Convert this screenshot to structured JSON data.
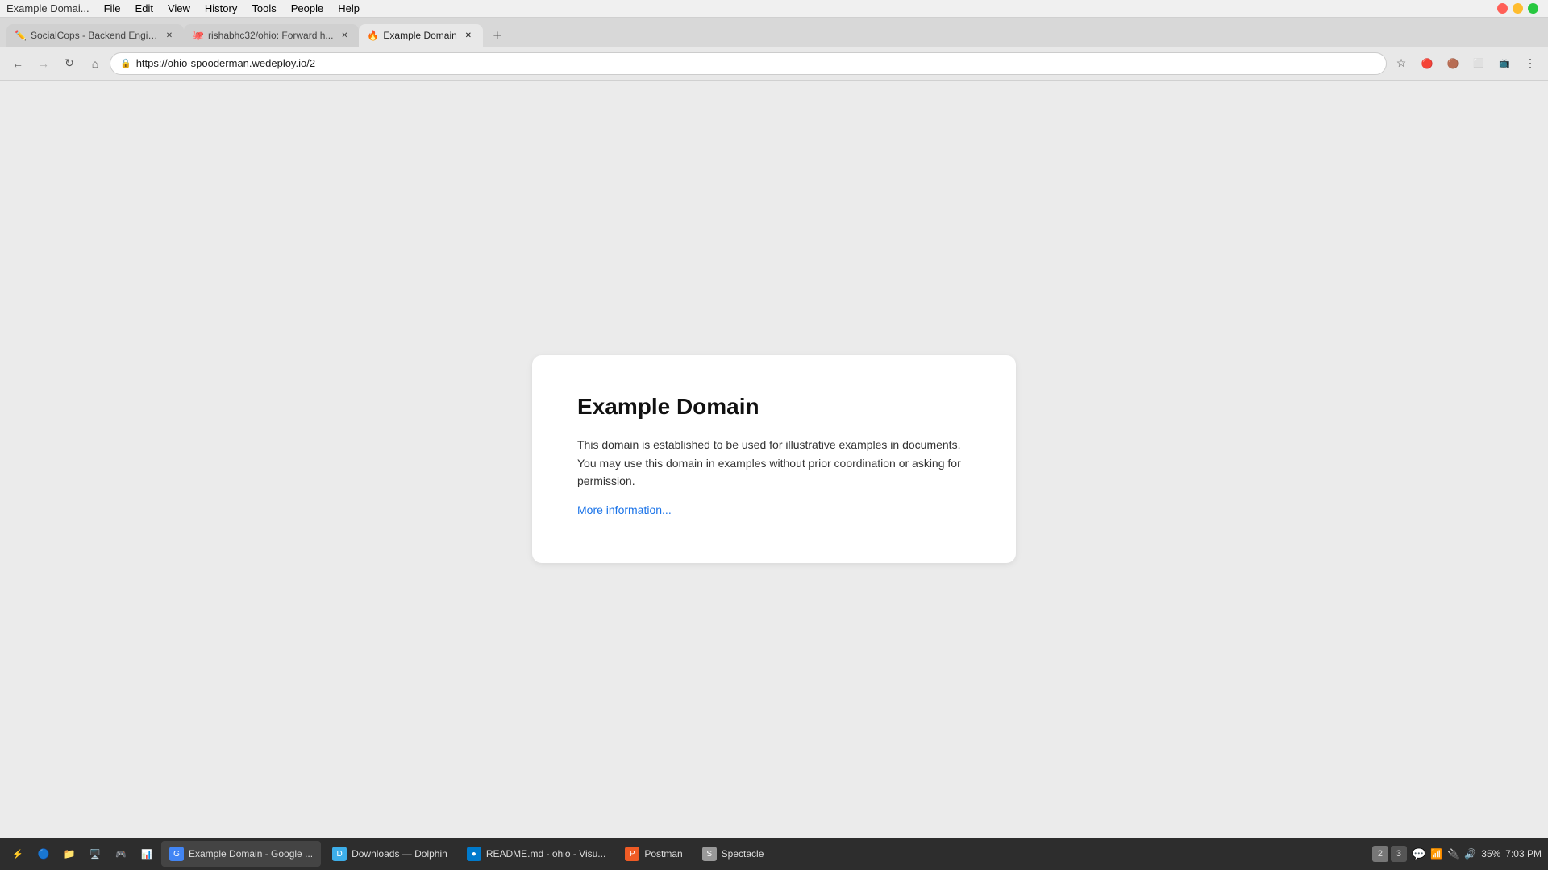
{
  "menubar": {
    "app_name": "Example Domai...",
    "items": [
      "File",
      "Edit",
      "View",
      "History",
      "Tools",
      "People",
      "Help"
    ]
  },
  "tabs": [
    {
      "id": "tab1",
      "title": "SocialCops - Backend Engine...",
      "favicon": "✏️",
      "active": false,
      "closable": true
    },
    {
      "id": "tab2",
      "title": "rishabhc32/ohio: Forward h...",
      "favicon": "🐙",
      "active": false,
      "closable": true
    },
    {
      "id": "tab3",
      "title": "Example Domain",
      "favicon": "🔥",
      "active": true,
      "closable": true
    }
  ],
  "new_tab_label": "+",
  "traffic_lights": {
    "close": "#ff5f57",
    "minimize": "#febc2e",
    "maximize": "#28c840"
  },
  "navbar": {
    "back_disabled": false,
    "forward_disabled": true,
    "url": "https://ohio-spooderman.wedeploy.io/2",
    "lock_icon": "🔒"
  },
  "page": {
    "title": "Example Domain",
    "description": "This domain is established to be used for illustrative examples in documents. You may use this domain in examples without prior coordination or asking for permission.",
    "link_text": "More information..."
  },
  "taskbar": {
    "system_tray_icons": [
      "⚡",
      "🔵",
      "📁",
      "🖥️",
      "🎮",
      "📊",
      "🌐",
      "📁"
    ],
    "apps": [
      {
        "name": "Example Domain - Google ...",
        "icon": "🌐",
        "active": true
      },
      {
        "name": "Downloads — Dolphin",
        "icon": "📁",
        "active": false
      },
      {
        "name": "README.md - ohio - Visu...",
        "icon": "📝",
        "active": false
      },
      {
        "name": "Postman",
        "icon": "📮",
        "active": false
      },
      {
        "name": "Spectacle",
        "icon": "📐",
        "active": false
      }
    ],
    "workspaces": [
      "2",
      "3"
    ],
    "active_workspace": "2",
    "time": "7:03 PM",
    "battery": "35%"
  }
}
